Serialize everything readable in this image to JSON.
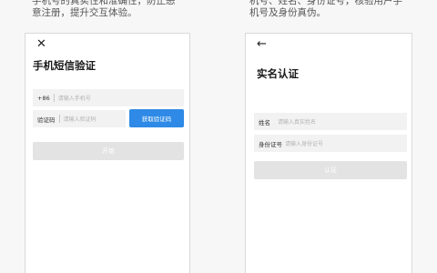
{
  "captions": {
    "left": "手机号的真实性和准确性，防止恶意注册，提升交互体验。",
    "right": "机号、姓名、身份证号，核验用户手机号及身份真伪。"
  },
  "left_screen": {
    "close_glyph": "✕",
    "title": "手机短信验证",
    "phone_field": {
      "prefix": "+86",
      "placeholder": "请输入手机号"
    },
    "code_field": {
      "label": "验证码",
      "placeholder": "请输入验证码"
    },
    "get_code_button": "获取验证码",
    "submit_button": "开始"
  },
  "right_screen": {
    "back_glyph": "←",
    "title": "实名认证",
    "name_field": {
      "label": "姓名",
      "placeholder": "请输入真实姓名"
    },
    "id_field": {
      "label": "身份证号",
      "placeholder": "请输入身份证号"
    },
    "submit_button": "认证"
  },
  "colors": {
    "accent": "#2e8ae6",
    "disabled_button": "#e3e3e3",
    "field_bg": "#f2f2f2"
  }
}
